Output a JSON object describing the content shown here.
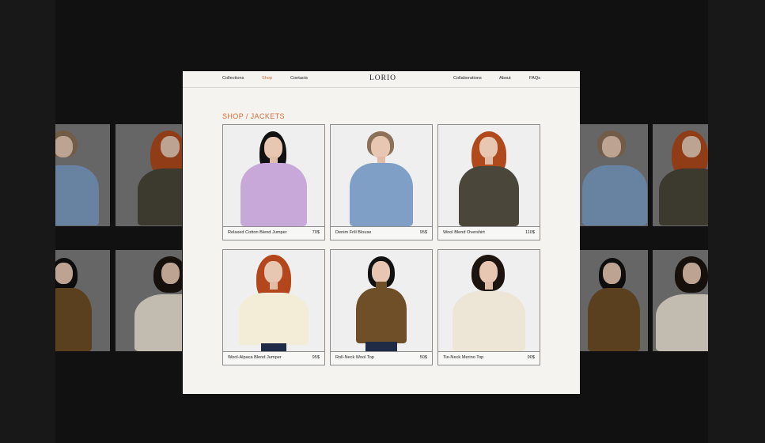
{
  "nav": {
    "left": [
      "Collections",
      "Shop",
      "Contacts"
    ],
    "right": [
      "Collaborations",
      "About",
      "FAQs"
    ],
    "logo": "LORIO",
    "active_color": "#d86d37"
  },
  "page": {
    "title": "SHOP / JACKETS"
  },
  "products": [
    {
      "name": "Relaxed Cotton Blend Jumper",
      "price": "70$",
      "garment_color": "#c8a8d8",
      "hair_color": "#111111"
    },
    {
      "name": "Denim Frill Blouse",
      "price": "95$",
      "garment_color": "#7f9fc6",
      "hair_color": "#8a7158"
    },
    {
      "name": "Wool Blend Overshirt",
      "price": "110$",
      "garment_color": "#4a4639",
      "hair_color": "#b04a1c"
    },
    {
      "name": "Wool-Alpaca Blend Jumper",
      "price": "95$",
      "garment_color": "#f3ecd6",
      "hair_color": "#b4461b"
    },
    {
      "name": "Roll-Neck Wool Top",
      "price": "50$",
      "garment_color": "#6f4f28",
      "hair_color": "#111111"
    },
    {
      "name": "Tie-Neck Merino Top",
      "price": "90$",
      "garment_color": "#ede6d7",
      "hair_color": "#1c140f"
    }
  ],
  "colors": {
    "page_background": "#181818",
    "site_background": "#f4f3f0",
    "accent": "#d86d37"
  }
}
